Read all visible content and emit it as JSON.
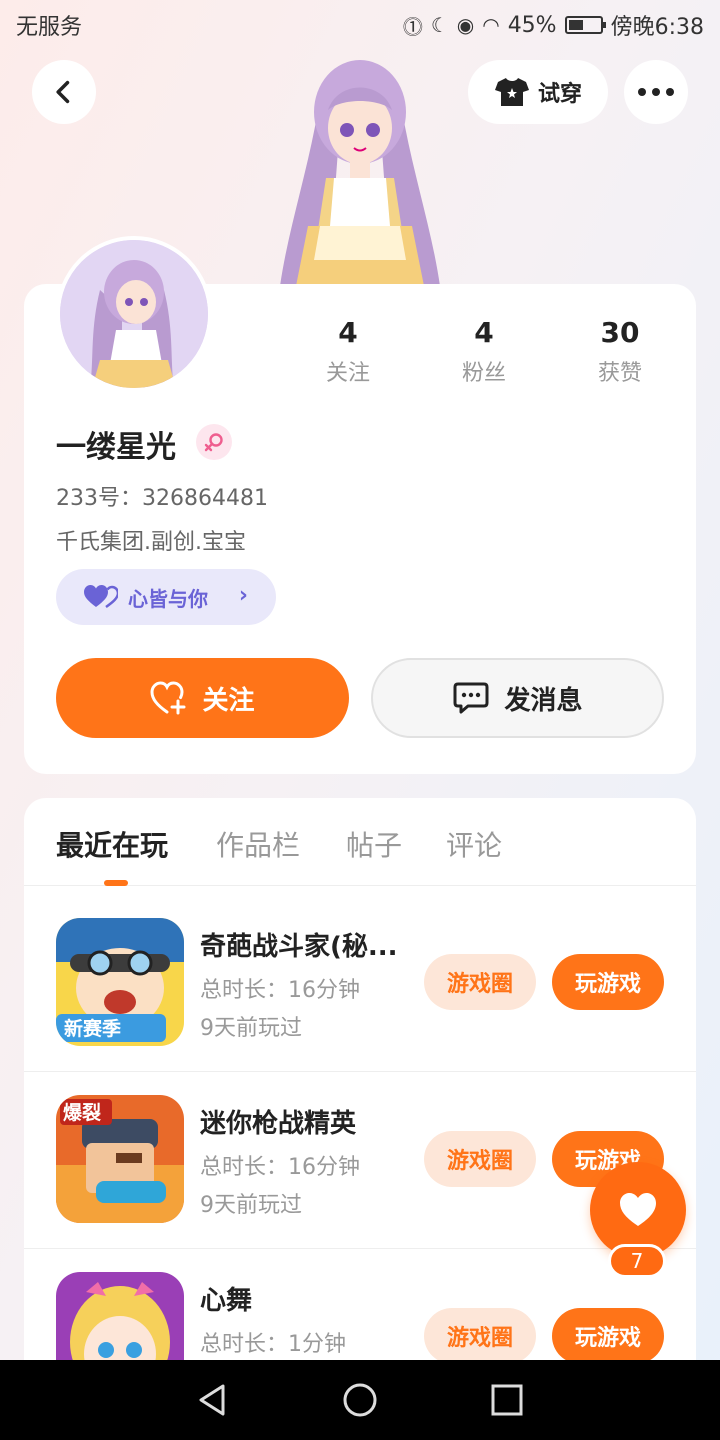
{
  "status_bar": {
    "carrier": "无服务",
    "battery": "45%",
    "time": "傍晚6:38"
  },
  "header": {
    "tryon_label": "试穿"
  },
  "profile": {
    "stats": [
      {
        "value": "4",
        "label": "关注"
      },
      {
        "value": "4",
        "label": "粉丝"
      },
      {
        "value": "30",
        "label": "获赞"
      }
    ],
    "nickname": "一缕星光",
    "uid": "233号：326864481",
    "bio": "千氏集团.副创.宝宝",
    "tag": "心皆与你",
    "follow_label": "关注",
    "message_label": "发消息"
  },
  "tabs": [
    {
      "label": "最近在玩",
      "active": true
    },
    {
      "label": "作品栏",
      "active": false
    },
    {
      "label": "帖子",
      "active": false
    },
    {
      "label": "评论",
      "active": false
    }
  ],
  "games": [
    {
      "name": "奇葩战斗家(秘...",
      "duration": "总时长：16分钟",
      "last_played": "9天前玩过",
      "icon_badge": "新赛季"
    },
    {
      "name": "迷你枪战精英",
      "duration": "总时长：16分钟",
      "last_played": "9天前玩过",
      "icon_badge": "爆裂"
    },
    {
      "name": "心舞",
      "duration": "总时长：1分钟",
      "last_played": ""
    }
  ],
  "game_actions": {
    "circle_label": "游戏圈",
    "play_label": "玩游戏"
  },
  "floating_like": {
    "count": "7"
  },
  "colors": {
    "accent": "#ff7418",
    "tag_purple": "#6a63d6"
  }
}
